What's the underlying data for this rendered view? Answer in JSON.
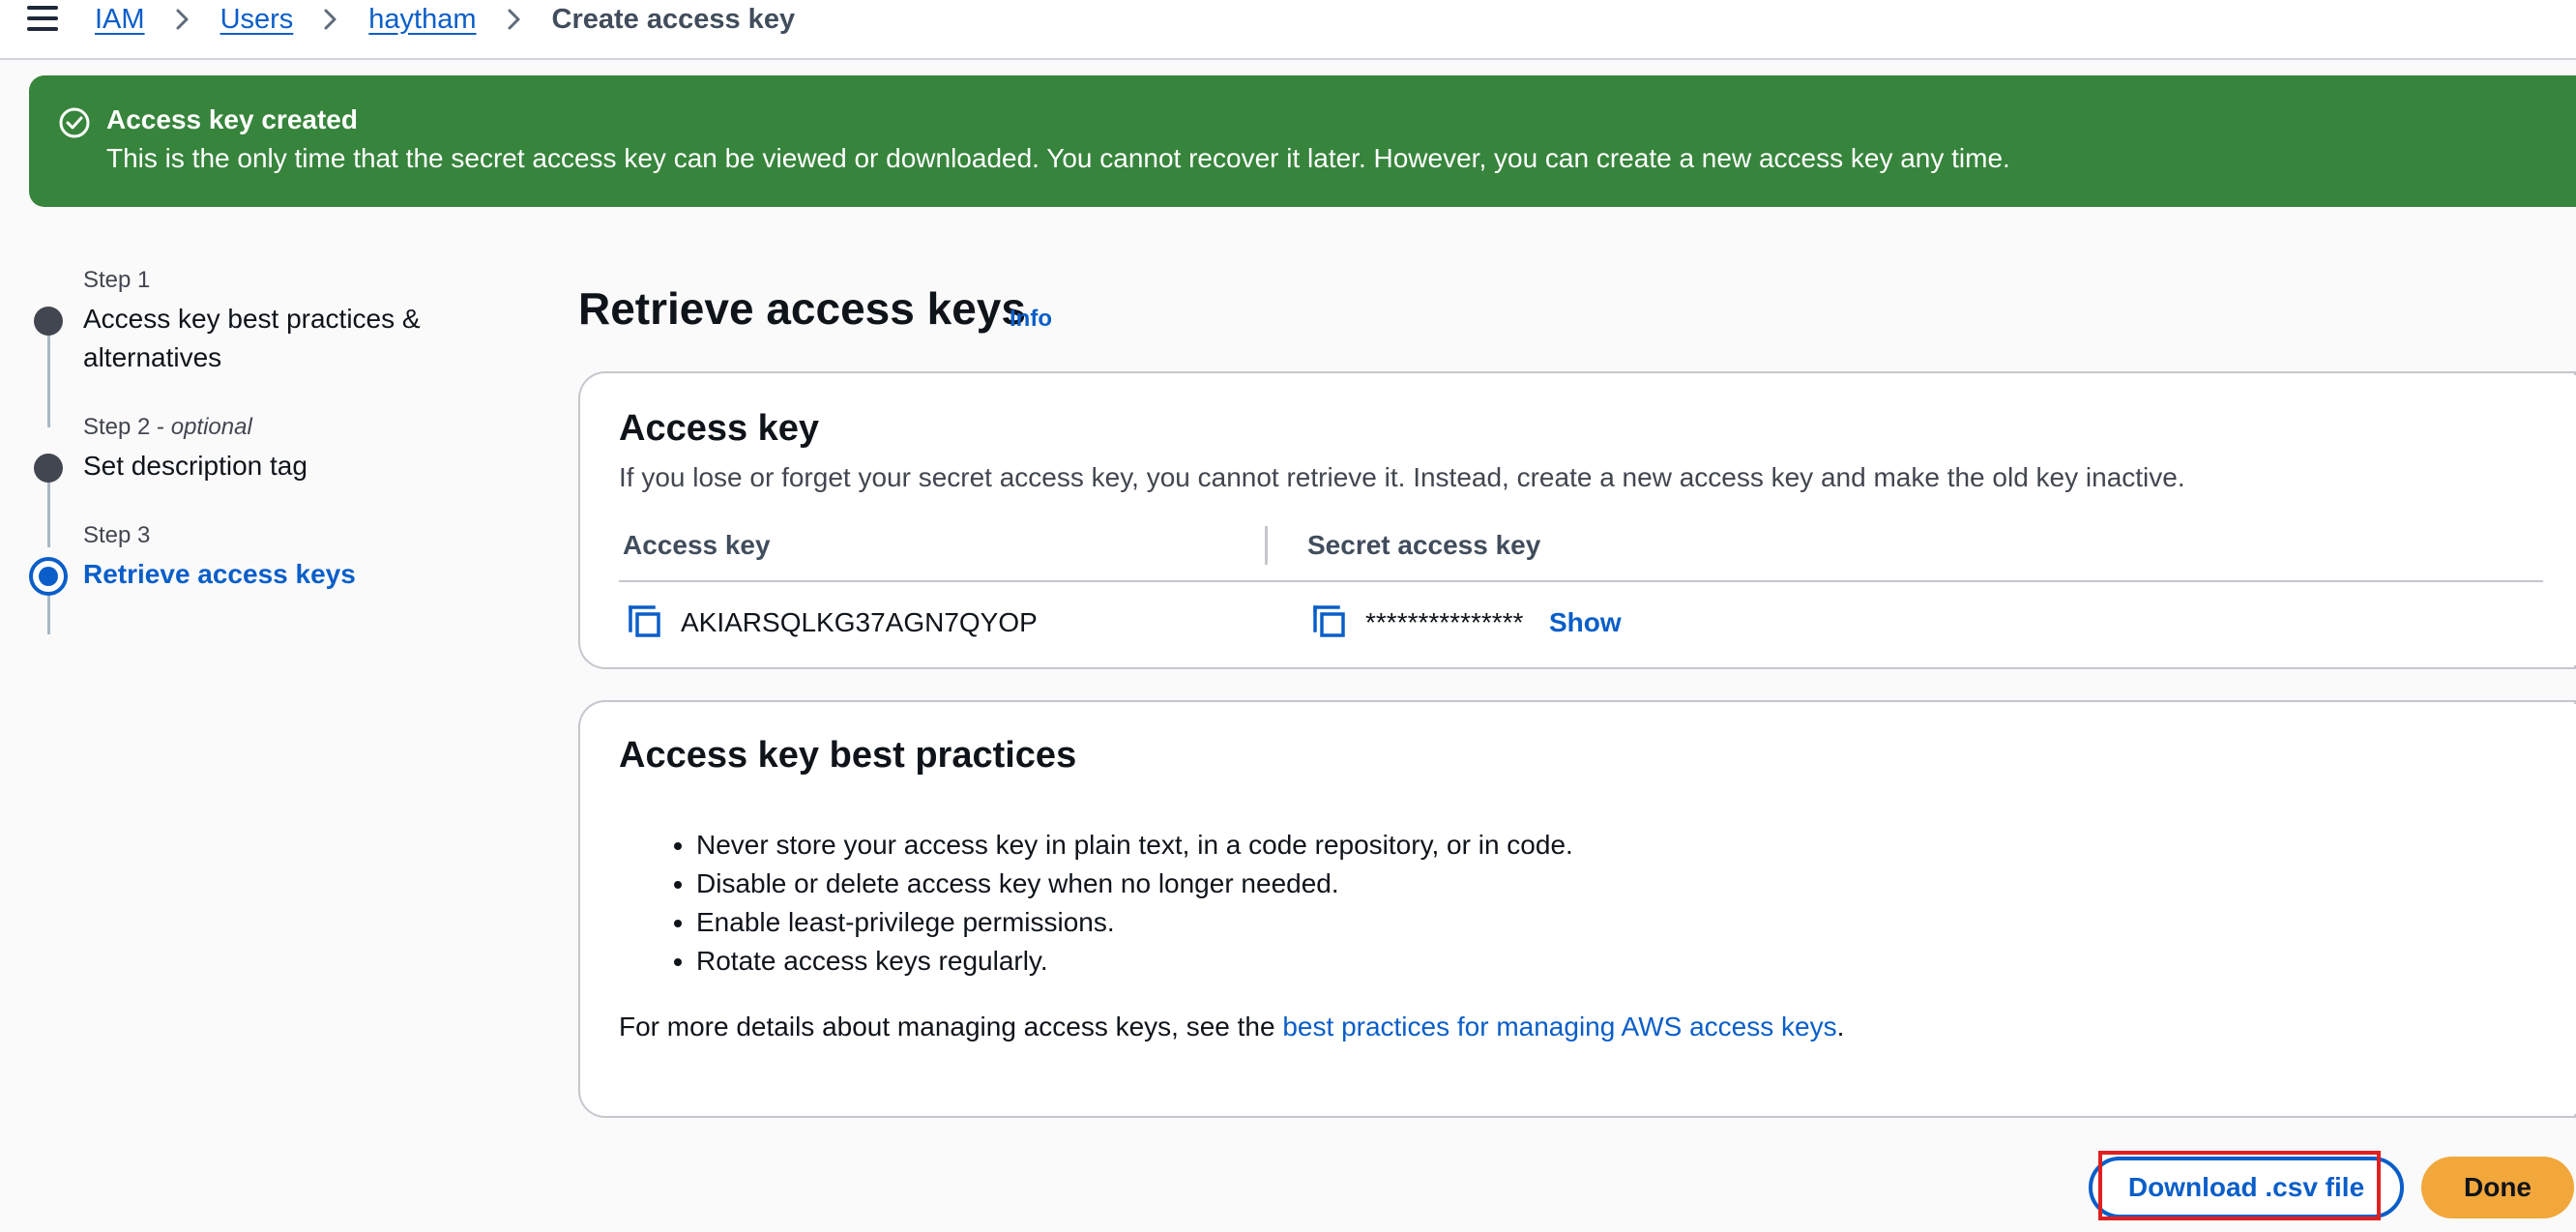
{
  "breadcrumb": {
    "items": [
      "IAM",
      "Users",
      "haytham"
    ],
    "current": "Create access key"
  },
  "flash": {
    "type": "success",
    "title": "Access key created",
    "message": "This is the only time that the secret access key can be viewed or downloaded. You cannot recover it later. However, you can create a new access key any time."
  },
  "steps": [
    {
      "number": "Step 1",
      "optional": "",
      "title": "Access key best practices & alternatives",
      "state": "completed"
    },
    {
      "number": "Step 2",
      "optional": "optional",
      "title": "Set description tag",
      "state": "completed"
    },
    {
      "number": "Step 3",
      "optional": "",
      "title": "Retrieve access keys",
      "state": "active"
    }
  ],
  "page": {
    "title": "Retrieve access keys",
    "info_label": "Info"
  },
  "access_key_panel": {
    "header": "Access key",
    "description": "If you lose or forget your secret access key, you cannot retrieve it. Instead, create a new access key and make the old key inactive.",
    "col_access_key": "Access key",
    "col_secret_key": "Secret access key",
    "access_key_value": "AKIARSQLKG37AGN7QYOP",
    "secret_key_masked": "***************",
    "show_label": "Show"
  },
  "best_practices_panel": {
    "header": "Access key best practices",
    "items": [
      "Never store your access key in plain text, in a code repository, or in code.",
      "Disable or delete access key when no longer needed.",
      "Enable least-privilege permissions.",
      "Rotate access keys regularly."
    ],
    "more_prefix": "For more details about managing access keys, see the ",
    "more_link": "best practices for managing AWS access keys",
    "more_suffix": "."
  },
  "footer": {
    "download_label": "Download .csv file",
    "done_label": "Done"
  },
  "colors": {
    "primary": "#0a5ec9",
    "success": "#37843c",
    "done_button": "#f2a73b",
    "highlight": "#e02020"
  }
}
